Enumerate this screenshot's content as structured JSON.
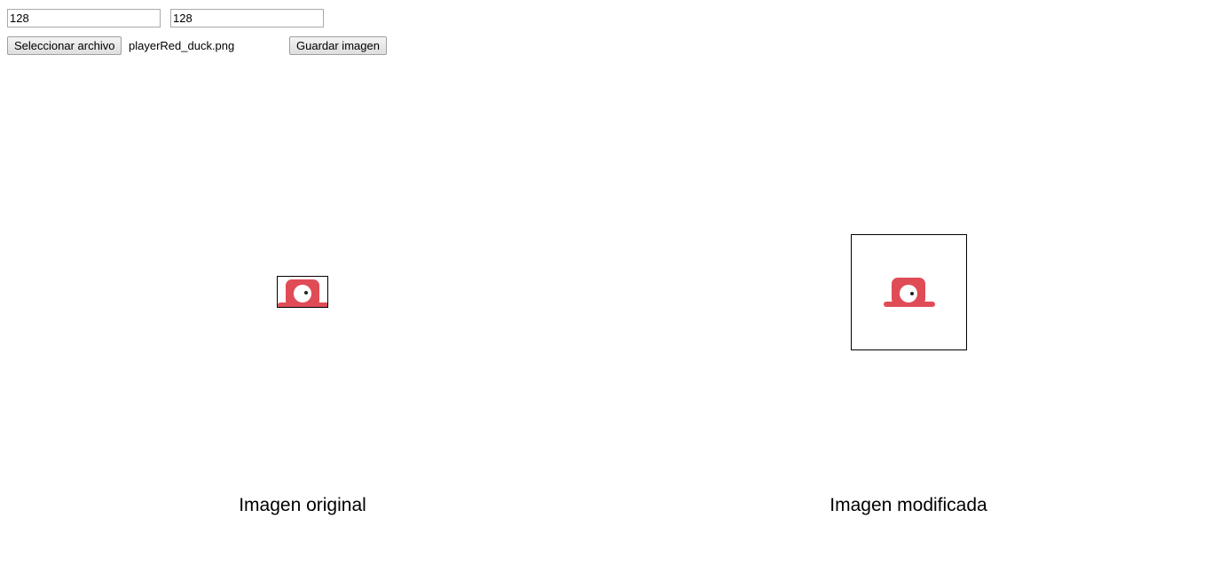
{
  "controls": {
    "width_value": "128",
    "height_value": "128",
    "file_button_label": "Seleccionar archivo",
    "file_name": "playerRed_duck.png",
    "save_button_label": "Guardar imagen"
  },
  "images": {
    "original_caption": "Imagen original",
    "modified_caption": "Imagen modificada",
    "sprite_icon": "red-duck-sprite-icon",
    "sprite_color": "#e04c56"
  }
}
